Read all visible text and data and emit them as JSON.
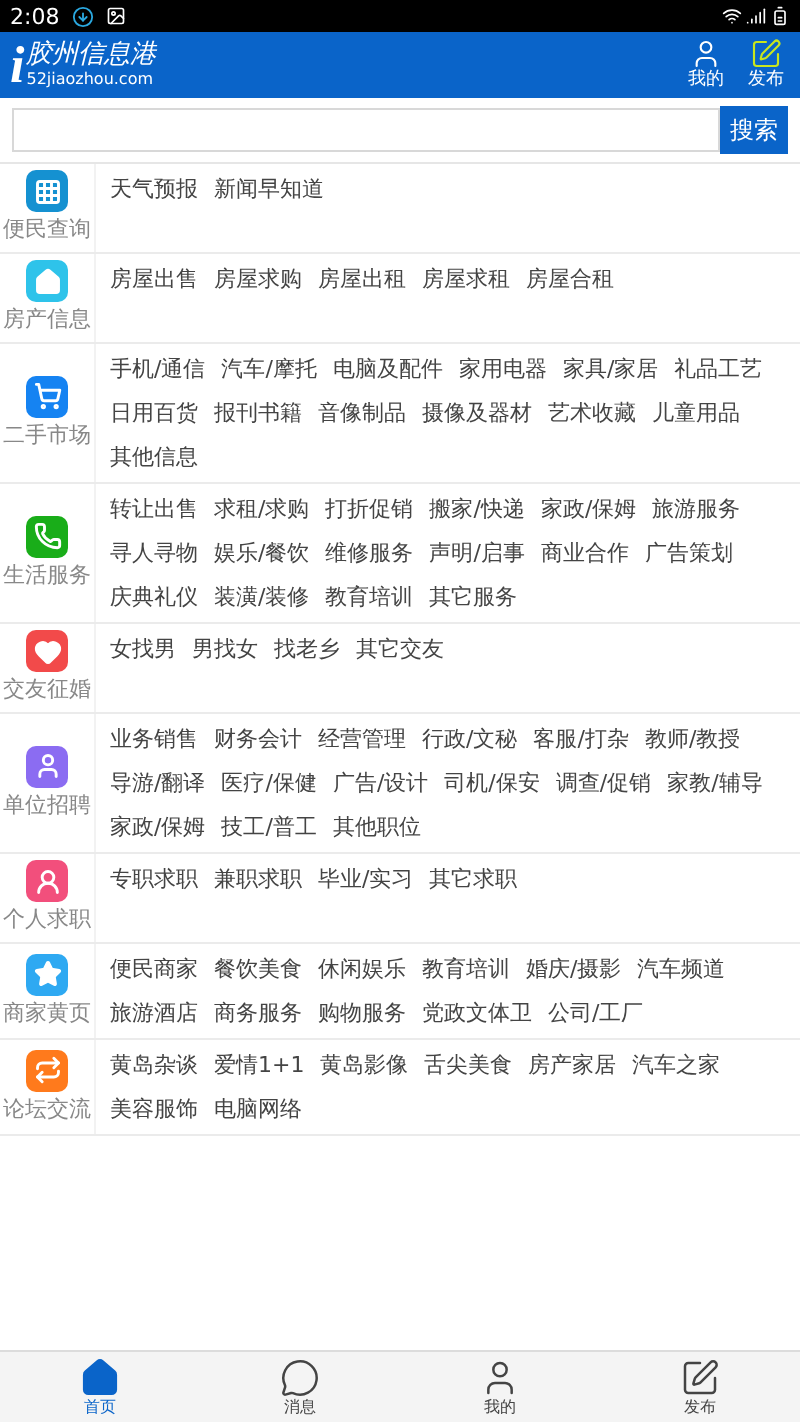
{
  "status_bar": {
    "time": "2:08"
  },
  "header": {
    "logo_mark": "i",
    "logo_title": "胶州信息港",
    "logo_domain": "52jiaozhou.com",
    "actions": [
      {
        "kind": "user",
        "label": "我的"
      },
      {
        "kind": "post",
        "label": "发布"
      }
    ]
  },
  "search": {
    "button": "搜索"
  },
  "categories": [
    {
      "name": "便民查询",
      "kind": "grid",
      "color": "#1591d1",
      "links": [
        "天气预报",
        "新闻早知道"
      ]
    },
    {
      "name": "房产信息",
      "kind": "house",
      "color": "#2ec3ea",
      "links": [
        "房屋出售",
        "房屋求购",
        "房屋出租",
        "房屋求租",
        "房屋合租"
      ]
    },
    {
      "name": "二手市场",
      "kind": "cart",
      "color": "#1583f2",
      "links": [
        "手机/通信",
        "汽车/摩托",
        "电脑及配件",
        "家用电器",
        "家具/家居",
        "礼品工艺",
        "日用百货",
        "报刊书籍",
        "音像制品",
        "摄像及器材",
        "艺术收藏",
        "儿童用品",
        "其他信息"
      ]
    },
    {
      "name": "生活服务",
      "kind": "phone",
      "color": "#19ad19",
      "links": [
        "转让出售",
        "求租/求购",
        "打折促销",
        "搬家/快递",
        "家政/保姆",
        "旅游服务",
        "寻人寻物",
        "娱乐/餐饮",
        "维修服务",
        "声明/启事",
        "商业合作",
        "广告策划",
        "庆典礼仪",
        "装潢/装修",
        "教育培训",
        "其它服务"
      ]
    },
    {
      "name": "交友征婚",
      "kind": "heart",
      "color": "#f24a4a",
      "links": [
        "女找男",
        "男找女",
        "找老乡",
        "其它交友"
      ]
    },
    {
      "name": "单位招聘",
      "kind": "person",
      "color": "#8b6cf2",
      "links": [
        "业务销售",
        "财务会计",
        "经营管理",
        "行政/文秘",
        "客服/打杂",
        "教师/教授",
        "导游/翻译",
        "医疗/保健",
        "广告/设计",
        "司机/保安",
        "调查/促销",
        "家教/辅导",
        "家政/保姆",
        "技工/普工",
        "其他职位"
      ]
    },
    {
      "name": "个人求职",
      "kind": "seeker",
      "color": "#f24f7c",
      "links": [
        "专职求职",
        "兼职求职",
        "毕业/实习",
        "其它求职"
      ]
    },
    {
      "name": "商家黄页",
      "kind": "star",
      "color": "#2ea9f2",
      "links": [
        "便民商家",
        "餐饮美食",
        "休闲娱乐",
        "教育培训",
        "婚庆/摄影",
        "汽车频道",
        "旅游酒店",
        "商务服务",
        "购物服务",
        "党政文体卫",
        "公司/工厂"
      ]
    },
    {
      "name": "论坛交流",
      "kind": "swap",
      "color": "#ff7a1c",
      "links": [
        "黄岛杂谈",
        "爱情1+1",
        "黄岛影像",
        "舌尖美食",
        "房产家居",
        "汽车之家",
        "美容服饰",
        "电脑网络"
      ]
    }
  ],
  "tab_bar": [
    {
      "kind": "home",
      "label": "首页",
      "selected": true
    },
    {
      "kind": "chat",
      "label": "消息",
      "selected": false
    },
    {
      "kind": "user",
      "label": "我的",
      "selected": false
    },
    {
      "kind": "post",
      "label": "发布",
      "selected": false
    }
  ]
}
